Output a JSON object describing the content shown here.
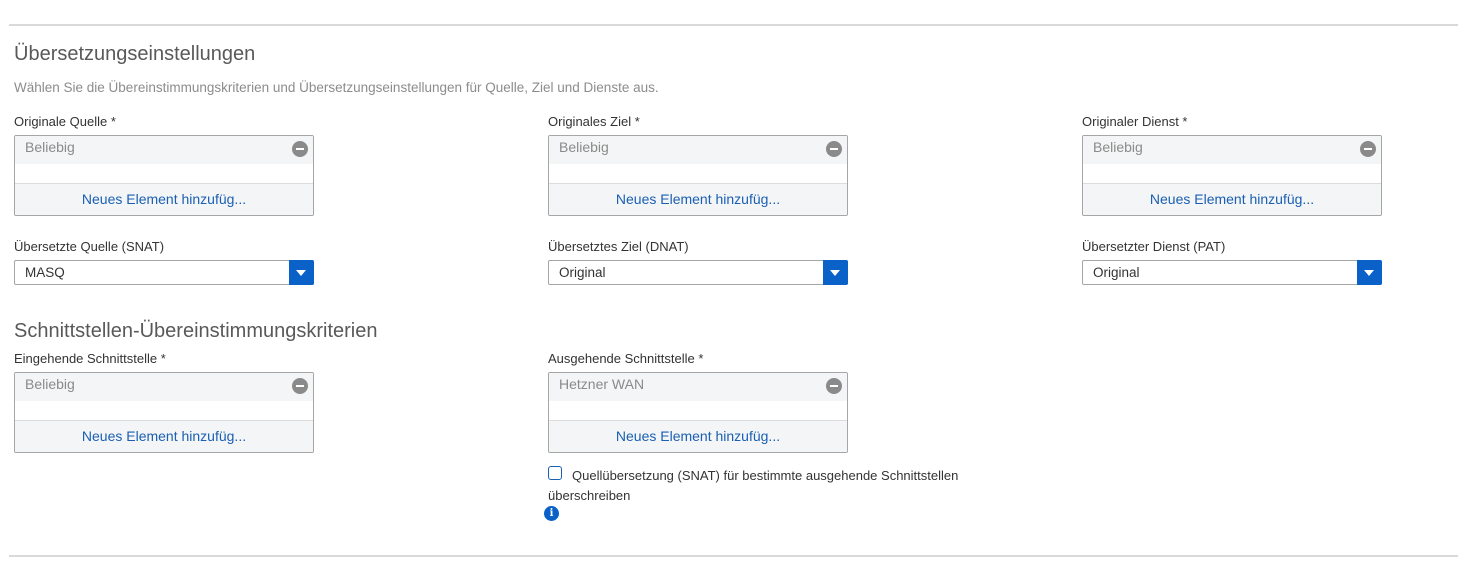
{
  "translation": {
    "title": "Übersetzungseinstellungen",
    "description": "Wählen Sie die Übereinstimmungskriterien und Übersetzungseinstellungen für Quelle, Ziel und Dienste aus.",
    "original_source": {
      "label": "Originale Quelle *",
      "item": "Beliebig",
      "add": "Neues Element hinzufüg..."
    },
    "original_destination": {
      "label": "Originales Ziel *",
      "item": "Beliebig",
      "add": "Neues Element hinzufüg..."
    },
    "original_service": {
      "label": "Originaler Dienst *",
      "item": "Beliebig",
      "add": "Neues Element hinzufüg..."
    },
    "translated_source": {
      "label": "Übersetzte Quelle (SNAT)",
      "value": "MASQ"
    },
    "translated_destination": {
      "label": "Übersetztes Ziel (DNAT)",
      "value": "Original"
    },
    "translated_service": {
      "label": "Übersetzter Dienst (PAT)",
      "value": "Original"
    }
  },
  "interface": {
    "title": "Schnittstellen-Übereinstimmungskriterien",
    "inbound": {
      "label": "Eingehende Schnittstelle *",
      "item": "Beliebig",
      "add": "Neues Element hinzufüg..."
    },
    "outbound": {
      "label": "Ausgehende Schnittstelle *",
      "item": "Hetzner WAN",
      "add": "Neues Element hinzufüg..."
    },
    "override_checkbox": {
      "label": "Quellübersetzung (SNAT) für bestimmte ausgehende Schnittstellen überschreiben",
      "checked": false
    },
    "info_glyph": "i"
  },
  "colors": {
    "accent": "#0a62c9",
    "link": "#1a5fb4"
  }
}
